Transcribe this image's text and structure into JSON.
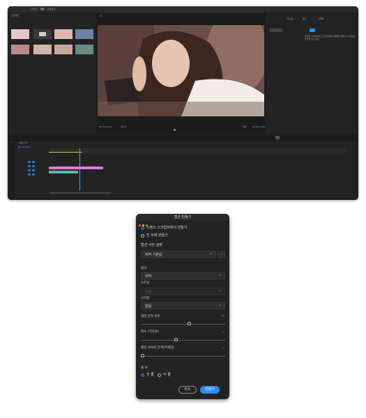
{
  "editor": {
    "top_labels": [
      "가져오기",
      "편집",
      "내보내기"
    ],
    "project_tab": "프로젝트",
    "source_tab": "소스",
    "preview_time": "00:00:03:04",
    "fit": "맞추기",
    "full": "전체",
    "duration": "00:00:15:00",
    "sequence_name": "시퀀스 01",
    "timeline_time": "00:00:03:04",
    "tools_panel": [
      "텍스트",
      "캡션",
      "그래픽"
    ],
    "right_panel_text": "캡션을 추가하려면 스크립트에서 캡션을 만들거나 새 캡션 트랙을 만드세요."
  },
  "dialog": {
    "title": "캡션 만들기",
    "option_transcript": "시퀀스 스크립트에서 만들기",
    "option_empty": "빈 트랙 만들기",
    "preset_label": "캡션 사전 설정",
    "preset_value": "자막 기본값",
    "more": "...",
    "format_label": "형식",
    "format_value": "자막",
    "stream_label": "스트림",
    "stream_value": "없음",
    "style_label": "스타일",
    "style_value": "없음",
    "max_length_label": "최대 문자 길이",
    "min_duration_label": "최소 기간(초)",
    "gap_label": "캡션 사이의 간격(프레임)",
    "lines_label": "줄 수",
    "single_line": "한 줄",
    "double_line": "두 줄",
    "cancel": "취소",
    "create": "만들기"
  },
  "colors": {
    "accent": "#2d8cf0",
    "clip_pink": "#e07bd6",
    "clip_teal": "#5bb7a6",
    "playhead": "#4da3ff"
  }
}
